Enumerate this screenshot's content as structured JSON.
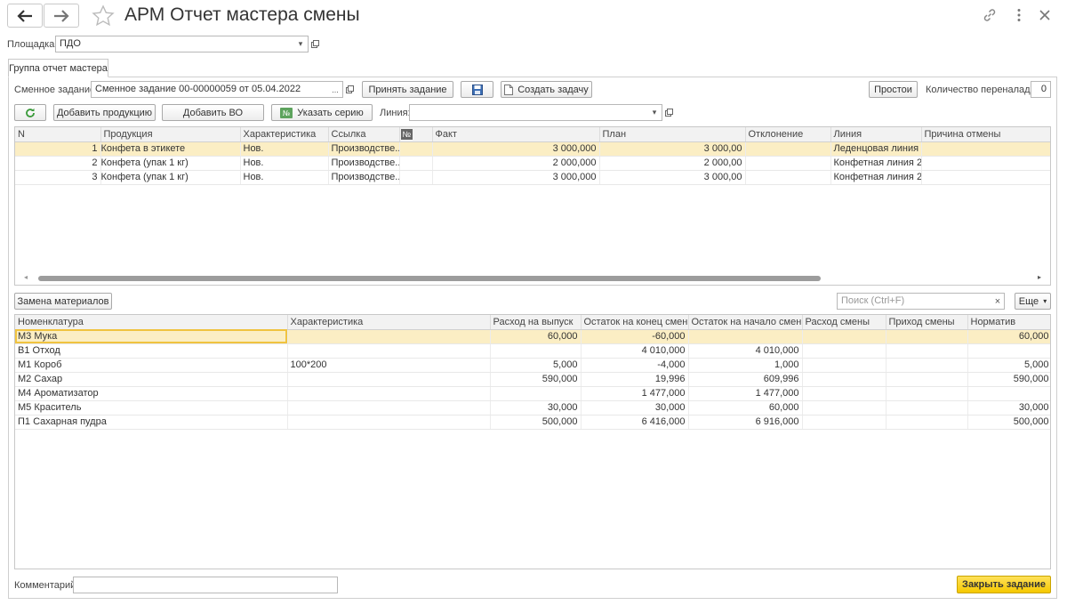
{
  "window": {
    "title": "АРМ Отчет мастера смены"
  },
  "site": {
    "label": "Площадка:",
    "value": "ПДО"
  },
  "tab": {
    "label": "Группа отчет мастера"
  },
  "shift_task": {
    "label": "Сменное задание:",
    "value": "Сменное задание 00-00000059 от 05.04.2022",
    "ellipsis": "..."
  },
  "buttons": {
    "accept_task": "Принять задание",
    "create_task": "Создать задачу",
    "downtime": "Простои",
    "add_product": "Добавить продукцию",
    "add_vo": "Добавить ВО",
    "set_series": "Указать серию",
    "replace_materials": "Замена материалов",
    "more": "Еще",
    "close_task": "Закрыть задание"
  },
  "changeovers": {
    "label": "Количество переналадок:",
    "value": "0"
  },
  "line_filter": {
    "label": "Линия:",
    "value": ""
  },
  "products_table": {
    "columns": [
      "N",
      "Продукция",
      "Характеристика",
      "Ссылка",
      "№",
      "Факт",
      "План",
      "Отклонение",
      "Линия",
      "Причина отмены"
    ],
    "rows": [
      {
        "n": "1",
        "product": "Конфета в этикете",
        "characteristic": "Нов.",
        "link": "Производстве...",
        "flag": "",
        "fact": "3 000,000",
        "plan": "3 000,00",
        "deviation": "",
        "line": "Леденцовая линия",
        "reason": ""
      },
      {
        "n": "2",
        "product": "Конфета (упак 1 кг)",
        "characteristic": "Нов.",
        "link": "Производстве...",
        "flag": "",
        "fact": "2 000,000",
        "plan": "2 000,00",
        "deviation": "",
        "line": "Конфетная линия 2.1",
        "reason": ""
      },
      {
        "n": "3",
        "product": "Конфета (упак 1 кг)",
        "characteristic": "Нов.",
        "link": "Производстве...",
        "flag": "",
        "fact": "3 000,000",
        "plan": "3 000,00",
        "deviation": "",
        "line": "Конфетная линия 2.2",
        "reason": ""
      }
    ]
  },
  "search": {
    "placeholder": "Поиск (Ctrl+F)",
    "clear": "×"
  },
  "materials_table": {
    "columns": [
      "Номенклатура",
      "Характеристика",
      "Расход на выпуск",
      "Остаток на конец смены",
      "Остаток на начало смены",
      "Расход смены",
      "Приход смены",
      "Норматив"
    ],
    "rows": [
      {
        "name": "М3 Мука",
        "characteristic": "",
        "usage": "60,000",
        "end": "-60,000",
        "start": "",
        "shift_usage": "",
        "shift_income": "",
        "norm": "60,000"
      },
      {
        "name": "В1 Отход",
        "characteristic": "",
        "usage": "",
        "end": "4 010,000",
        "start": "4 010,000",
        "shift_usage": "",
        "shift_income": "",
        "norm": ""
      },
      {
        "name": "М1 Короб",
        "characteristic": "100*200",
        "usage": "5,000",
        "end": "-4,000",
        "start": "1,000",
        "shift_usage": "",
        "shift_income": "",
        "norm": "5,000"
      },
      {
        "name": "М2 Сахар",
        "characteristic": "",
        "usage": "590,000",
        "end": "19,996",
        "start": "609,996",
        "shift_usage": "",
        "shift_income": "",
        "norm": "590,000"
      },
      {
        "name": "М4 Ароматизатор",
        "characteristic": "",
        "usage": "",
        "end": "1 477,000",
        "start": "1 477,000",
        "shift_usage": "",
        "shift_income": "",
        "norm": ""
      },
      {
        "name": "М5 Краситель",
        "characteristic": "",
        "usage": "30,000",
        "end": "30,000",
        "start": "60,000",
        "shift_usage": "",
        "shift_income": "",
        "norm": "30,000"
      },
      {
        "name": "П1 Сахарная пудра",
        "characteristic": "",
        "usage": "500,000",
        "end": "6 416,000",
        "start": "6 916,000",
        "shift_usage": "",
        "shift_income": "",
        "norm": "500,000"
      }
    ]
  },
  "comment": {
    "label": "Комментарий:",
    "value": ""
  },
  "icons": {
    "back": "arrow-left-icon",
    "forward": "arrow-right-icon",
    "favorite": "star-icon",
    "link": "chain-link-icon",
    "more": "vertical-dots-icon",
    "close": "close-icon",
    "refresh": "refresh-icon",
    "save": "floppy-disk-icon",
    "create": "document-icon",
    "series": "number-sign-icon"
  },
  "colors": {
    "selection": "#fbeec4",
    "primary_button": "#f5c800",
    "refresh_green": "#3a9a3a"
  }
}
